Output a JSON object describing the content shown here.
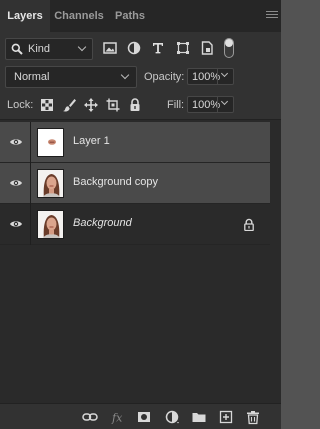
{
  "tabs": [
    {
      "label": "Layers",
      "active": true
    },
    {
      "label": "Channels",
      "active": false
    },
    {
      "label": "Paths",
      "active": false
    }
  ],
  "filter": {
    "kind_label": "Kind",
    "icons": [
      "pixel-filter-icon",
      "adjustment-filter-icon",
      "type-filter-icon",
      "shape-filter-icon",
      "smart-object-filter-icon"
    ]
  },
  "blend": {
    "mode": "Normal"
  },
  "opacity": {
    "label": "Opacity:",
    "value": "100%"
  },
  "lock": {
    "label": "Lock:",
    "icons": [
      "lock-transparent-pixels-icon",
      "lock-image-pixels-icon",
      "lock-position-icon",
      "prevent-autonest-icon",
      "lock-all-icon"
    ]
  },
  "fill": {
    "label": "Fill:",
    "value": "100%"
  },
  "layers": [
    {
      "name": "Layer 1",
      "selected": true,
      "thumb": "transparent",
      "italic": false,
      "locked": false
    },
    {
      "name": "Background copy",
      "selected": true,
      "thumb": "photo",
      "italic": false,
      "locked": false
    },
    {
      "name": "Background",
      "selected": false,
      "thumb": "photo",
      "italic": true,
      "locked": true
    }
  ],
  "footer_icons": [
    "link-layers-icon",
    "fx-icon",
    "layer-mask-icon",
    "adjustment-layer-icon",
    "new-group-icon",
    "new-layer-icon",
    "trash-icon"
  ],
  "colors": {
    "panel": "#323232",
    "selected_row": "#4a4a4a",
    "list_bg": "#2a2a2a"
  }
}
